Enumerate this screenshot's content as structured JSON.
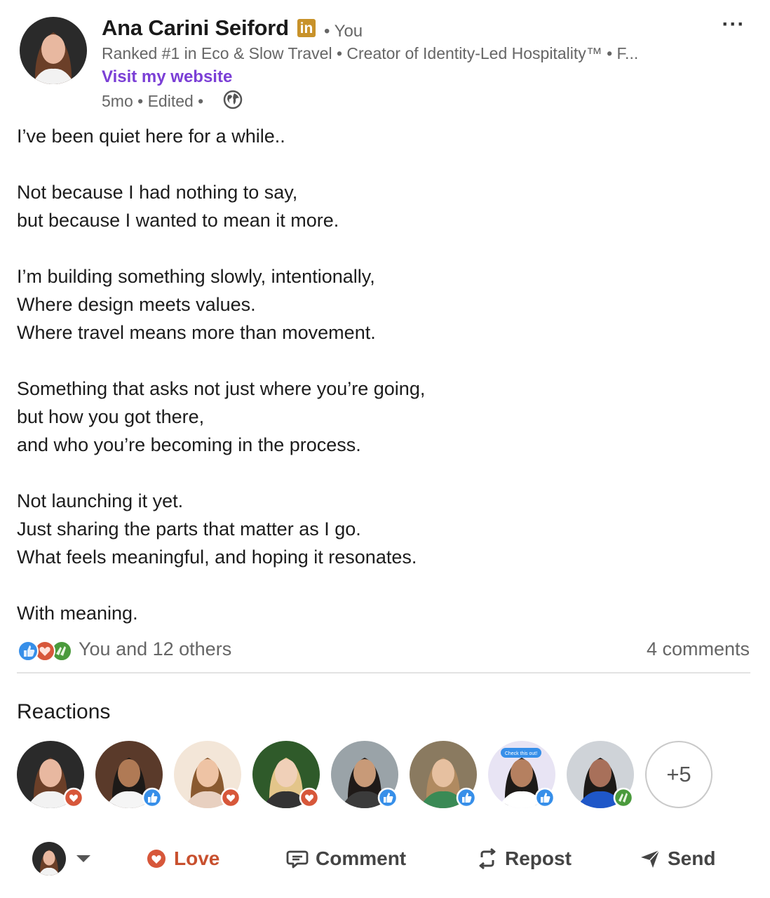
{
  "author": {
    "name": "Ana Carini Seiford",
    "badge": "in",
    "relation": "• You",
    "headline": "Ranked #1 in Eco & Slow Travel • Creator of Identity-Led Hospitality™ • F...",
    "website_link": "Visit my website",
    "meta": "5mo • Edited •"
  },
  "post": {
    "lines": [
      "I’ve been quiet here for a while..",
      "",
      "Not because I had nothing to say,",
      "but because I wanted to mean it more.",
      "",
      "I’m building something slowly, intentionally,",
      "Where design meets values.",
      "Where travel means more than movement.",
      "",
      "Something that asks not just where you’re going,",
      "but how you got there,",
      "and who you’re becoming in the process.",
      "",
      "Not launching it yet.",
      "Just sharing the parts that matter as I go.",
      "What feels meaningful, and hoping it resonates.",
      "",
      "With meaning."
    ]
  },
  "social": {
    "reaction_types": [
      "like",
      "love",
      "celebrate"
    ],
    "reactors_text": "You and 12 others",
    "comments_text": "4 comments"
  },
  "reactions_section": {
    "heading": "Reactions",
    "reactors": [
      {
        "reaction": "love",
        "skin": "#e8b8a0",
        "hair": "#6b3f28",
        "bg": "#2a2a2a",
        "shirt": "#f2f2f2"
      },
      {
        "reaction": "like",
        "skin": "#b07a55",
        "hair": "#1d1a18",
        "bg": "#5a3a2a",
        "shirt": "#f5f5f5"
      },
      {
        "reaction": "love",
        "skin": "#eec3a4",
        "hair": "#8a5a30",
        "bg": "#f3e6d8",
        "shirt": "#e8d0c0"
      },
      {
        "reaction": "love",
        "skin": "#f0d0b8",
        "hair": "#e3c58a",
        "bg": "#2f5a2a",
        "shirt": "#333333"
      },
      {
        "reaction": "like",
        "skin": "#c89a78",
        "hair": "#1f1a18",
        "bg": "#9aa3a8",
        "shirt": "#3b3b3b"
      },
      {
        "reaction": "like",
        "skin": "#e6c0a0",
        "hair": "#b08a60",
        "bg": "#8a7a60",
        "shirt": "#3a8a55"
      },
      {
        "reaction": "like",
        "skin": "#b58060",
        "hair": "#1d1a18",
        "bg": "#e8e4f4",
        "shirt": "#ffffff",
        "bubble_text": "Check this out!"
      },
      {
        "reaction": "celebrate",
        "skin": "#a8705a",
        "hair": "#1d1a18",
        "bg": "#cfd3d8",
        "shirt": "#1f57c8"
      }
    ],
    "more_count": "+5"
  },
  "actions": {
    "love": "Love",
    "comment": "Comment",
    "repost": "Repost",
    "send": "Send"
  },
  "colors": {
    "accent_purple": "#7b3fd6",
    "love": "#d7573a",
    "like": "#378fe9",
    "celebrate": "#4a9a3c",
    "linkedin_badge": "#c8922a"
  }
}
